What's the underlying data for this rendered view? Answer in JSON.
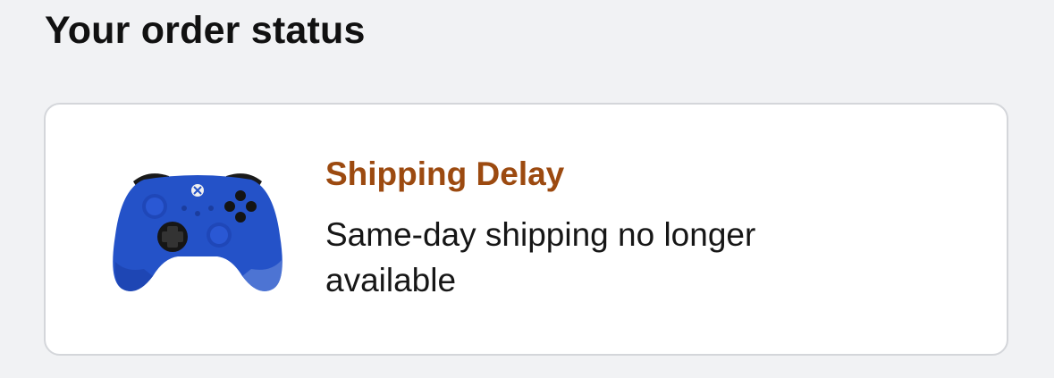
{
  "section": {
    "title": "Your order status"
  },
  "order": {
    "product_icon": "game-controller",
    "status_label": "Shipping Delay",
    "status_message": "Same-day shipping no longer available",
    "status_color": "#9c4a10",
    "product_color": "#2452c8"
  }
}
